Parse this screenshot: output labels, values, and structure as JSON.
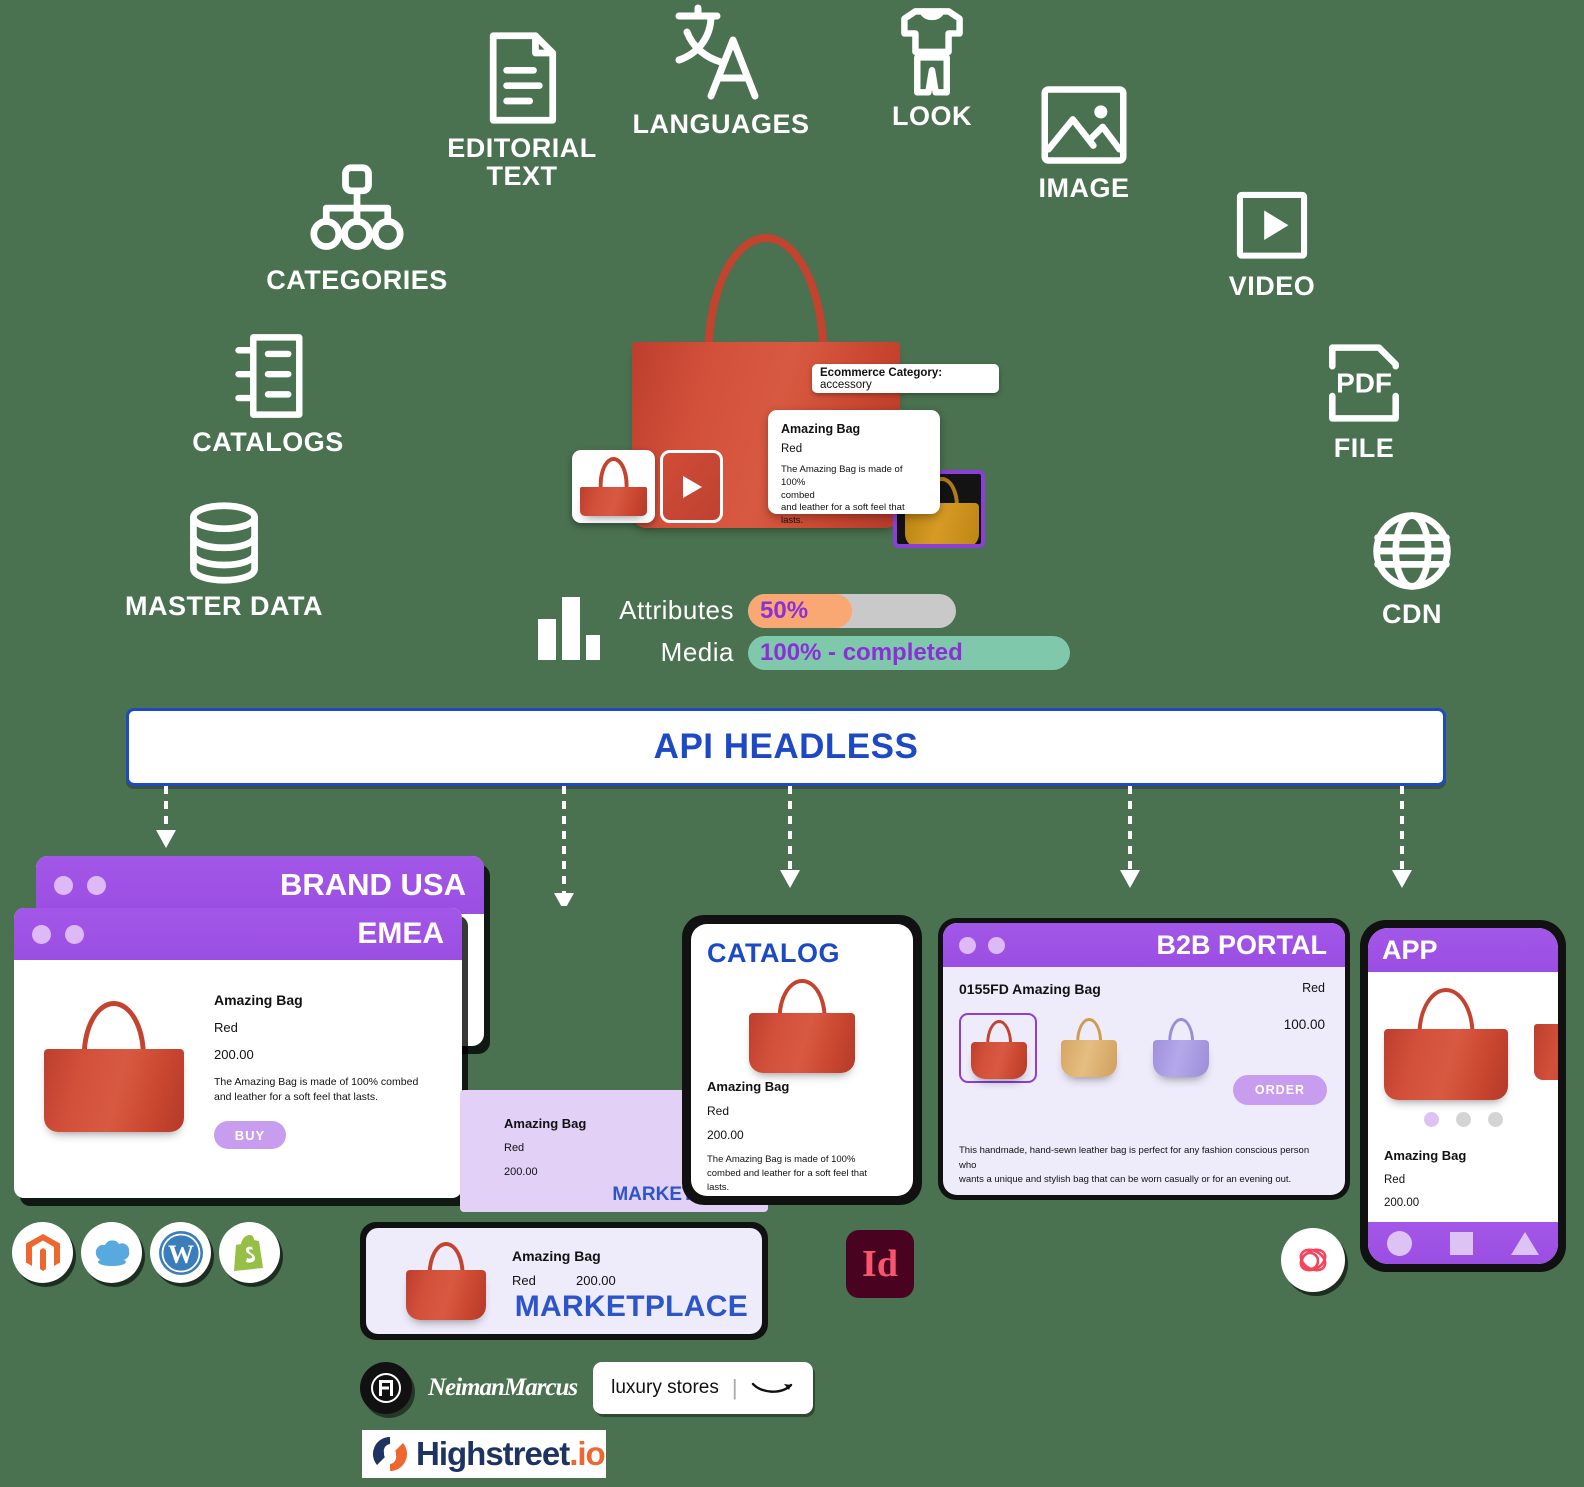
{
  "background_color": "#4a7150",
  "sources": [
    {
      "id": "categories",
      "label": "CATEGORIES",
      "icon": "sitemap-icon"
    },
    {
      "id": "editorial",
      "label": "EDITORIAL\nTEXT",
      "icon": "document-text-icon"
    },
    {
      "id": "languages",
      "label": "LANGUAGES",
      "icon": "translate-icon"
    },
    {
      "id": "look",
      "label": "LOOK",
      "icon": "apparel-icon"
    },
    {
      "id": "image",
      "label": "IMAGE",
      "icon": "image-icon"
    },
    {
      "id": "video",
      "label": "VIDEO",
      "icon": "video-play-icon"
    },
    {
      "id": "catalogs",
      "label": "CATALOGS",
      "icon": "notebook-icon"
    },
    {
      "id": "master_data",
      "label": "MASTER DATA",
      "icon": "database-icon"
    },
    {
      "id": "file",
      "label": "FILE",
      "icon": "pdf-file-icon"
    },
    {
      "id": "cdn",
      "label": "CDN",
      "icon": "globe-icon"
    }
  ],
  "hero": {
    "category_tag": {
      "label": "Ecommerce Category:",
      "value": "accessory"
    },
    "product_card": {
      "title": "Amazing Bag",
      "color": "Red",
      "description_line1": "The Amazing Bag is made of 100%",
      "description_line2": "combed",
      "description_line3": "and leather for a soft feel that lasts."
    },
    "thumbs": [
      {
        "name": "bag-thumbnail",
        "type": "image"
      },
      {
        "name": "video-thumbnail",
        "type": "video"
      }
    ]
  },
  "progress": {
    "chart_icon": "bar-chart-icon",
    "rows": [
      {
        "label": "Attributes",
        "value_text": "50%",
        "percent": 50,
        "fill_color": "#f9a874",
        "track_color": "#c9c9c9",
        "text_color": "#8b2fd6"
      },
      {
        "label": "Media",
        "value_text": "100% - completed",
        "percent": 100,
        "fill_color": "#7fc8ac",
        "track_color": "#7fc8ac",
        "text_color": "#8b2fd6"
      }
    ]
  },
  "api_bar": {
    "label": "API HEADLESS",
    "text_color": "#1d49c4",
    "border_color": "#1d49c4"
  },
  "channels": {
    "brand_usa": {
      "title": "BRAND USA"
    },
    "emea": {
      "title": "EMEA",
      "product": {
        "title": "Amazing Bag",
        "color": "Red",
        "price": "200.00",
        "description_line1": "The Amazing Bag is made of 100% combed",
        "description_line2": "and leather for a soft feel that lasts."
      },
      "buy_label": "BUY"
    },
    "marketplace_back": {
      "title": "MARKETPLACE",
      "product": {
        "title": "Amazing Bag",
        "color": "Red",
        "price": "200.00"
      }
    },
    "marketplace_front": {
      "title": "MARKETPLACE",
      "product": {
        "title": "Amazing Bag",
        "color": "Red",
        "price": "200.00"
      }
    },
    "catalog": {
      "title": "CATALOG",
      "product": {
        "title": "Amazing Bag",
        "color": "Red",
        "price": "200.00",
        "description_line1": "The Amazing Bag is made of 100%",
        "description_line2": "combed and leather for a soft feel that",
        "description_line3": "lasts."
      }
    },
    "b2b_portal": {
      "title": "B2B PORTAL",
      "sku_title": "0155FD Amazing Bag",
      "color": "Red",
      "price": "100.00",
      "order_label": "ORDER",
      "variants": [
        {
          "name": "red-bag-variant",
          "color": "#cc4733",
          "selected": true
        },
        {
          "name": "beige-bag-variant",
          "color": "#e0b070",
          "selected": false
        },
        {
          "name": "purple-bag-variant",
          "color": "#a89ae0",
          "selected": false
        }
      ],
      "description_line1": "This handmade, hand-sewn leather bag is perfect for any fashion conscious person who",
      "description_line2": "wants a unique and stylish bag that can be worn casually or for an evening out."
    },
    "app": {
      "title": "APP",
      "product": {
        "title": "Amazing Bag",
        "color": "Red",
        "price": "200.00"
      },
      "carousel_dots": 3,
      "nav_buttons": [
        "circle-nav-icon",
        "square-nav-icon",
        "triangle-nav-icon"
      ]
    }
  },
  "platform_logos": [
    {
      "name": "magento-logo",
      "label": "Magento",
      "color": "#ee672f"
    },
    {
      "name": "salesforce-logo",
      "label": "Salesforce",
      "color": "#58aade"
    },
    {
      "name": "wordpress-logo",
      "label": "WordPress",
      "color": "#3a7dbb"
    },
    {
      "name": "shopify-logo",
      "label": "Shopify",
      "color": "#95bf47"
    }
  ],
  "design_logo": {
    "name": "adobe-indesign-logo",
    "label": "Id",
    "bg": "#49021f",
    "fg": "#f8566d"
  },
  "app_logo": {
    "name": "vue-storefront-logo",
    "color": "#f4455e"
  },
  "retailer_logos": [
    {
      "name": "farfetch-logo",
      "label": "FF"
    },
    {
      "name": "neiman-marcus-logo",
      "label": "NeimanMarcus"
    },
    {
      "name": "amazon-luxury-stores-logo",
      "label": "luxury stores"
    }
  ],
  "brand_logo": {
    "name": "highstreet-io-logo",
    "text_main": "Highstreet",
    "text_accent": ".io",
    "main_color": "#1d3461",
    "accent_color": "#ee672f"
  }
}
